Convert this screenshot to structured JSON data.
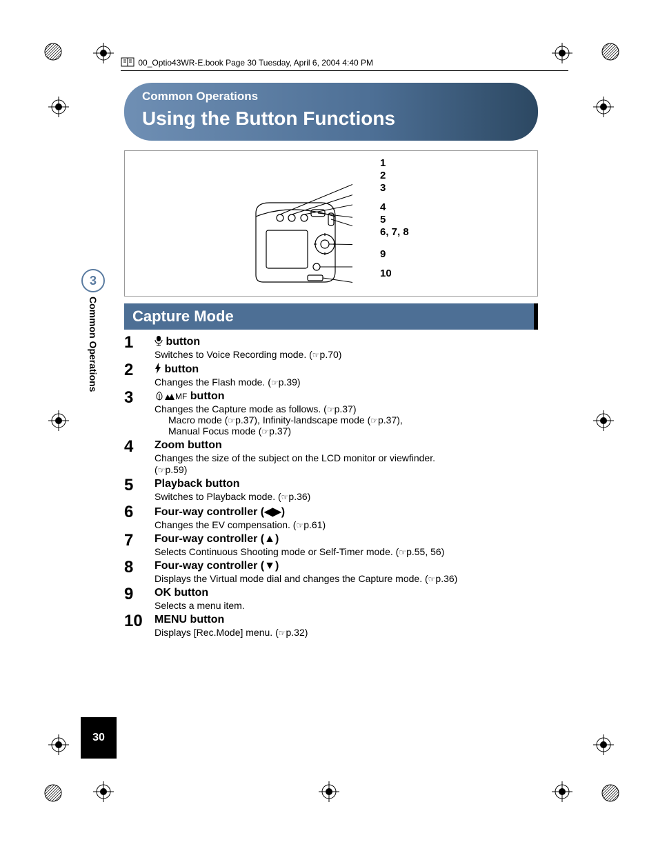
{
  "header_line": "00_Optio43WR-E.book  Page 30  Tuesday, April 6, 2004  4:40 PM",
  "banner": {
    "small": "Common Operations",
    "big": "Using the Button Functions"
  },
  "diagram_labels": [
    "1",
    "2",
    "3",
    "4",
    "5",
    "6, 7, 8",
    "9",
    "10"
  ],
  "section_title": "Capture Mode",
  "side": {
    "chapter_num": "3",
    "chapter_label": "Common Operations"
  },
  "page_number": "30",
  "items": [
    {
      "num": "1",
      "icon": "mic",
      "title_suffix": " button",
      "desc": "Switches to Voice Recording mode. (",
      "ref": "p.70",
      "desc_close": ")"
    },
    {
      "num": "2",
      "icon": "flash",
      "title_suffix": " button",
      "desc": "Changes the Flash mode. (",
      "ref": "p.39",
      "desc_close": ")"
    },
    {
      "num": "3",
      "icon": "macro-mountain-mf",
      "title_suffix": " button",
      "desc": "Changes the Capture mode as follows. (",
      "ref": "p.37",
      "desc_close": ")",
      "sub": {
        "line1_a": "Macro mode (",
        "line1_ref1": "p.37",
        "line1_b": "), Infinity-landscape mode (",
        "line1_ref2": "p.37",
        "line1_c": "),",
        "line2_a": "Manual Focus mode (",
        "line2_ref": "p.37",
        "line2_b": ")"
      }
    },
    {
      "num": "4",
      "title": "Zoom button",
      "desc": "Changes the size of the subject on the LCD monitor or viewfinder.",
      "desc2_open": "(",
      "ref": "p.59",
      "desc2_close": ")"
    },
    {
      "num": "5",
      "title": "Playback button",
      "desc": "Switches to Playback mode. (",
      "ref": "p.36",
      "desc_close": ")"
    },
    {
      "num": "6",
      "title": "Four-way controller (◀▶)",
      "desc": "Changes the EV compensation. (",
      "ref": "p.61",
      "desc_close": ")"
    },
    {
      "num": "7",
      "title": "Four-way controller (▲)",
      "desc": "Selects Continuous Shooting mode or Self-Timer mode. (",
      "ref": "p.55, 56",
      "desc_close": ")"
    },
    {
      "num": "8",
      "title": "Four-way controller (▼)",
      "desc": "Displays the Virtual mode dial and changes the Capture mode. (",
      "ref": "p.36",
      "desc_close": ")"
    },
    {
      "num": "9",
      "title": "OK button",
      "desc": "Selects a menu item."
    },
    {
      "num": "10",
      "title": "MENU button",
      "desc": "Displays [Rec.Mode] menu. (",
      "ref": "p.32",
      "desc_close": ")"
    }
  ]
}
